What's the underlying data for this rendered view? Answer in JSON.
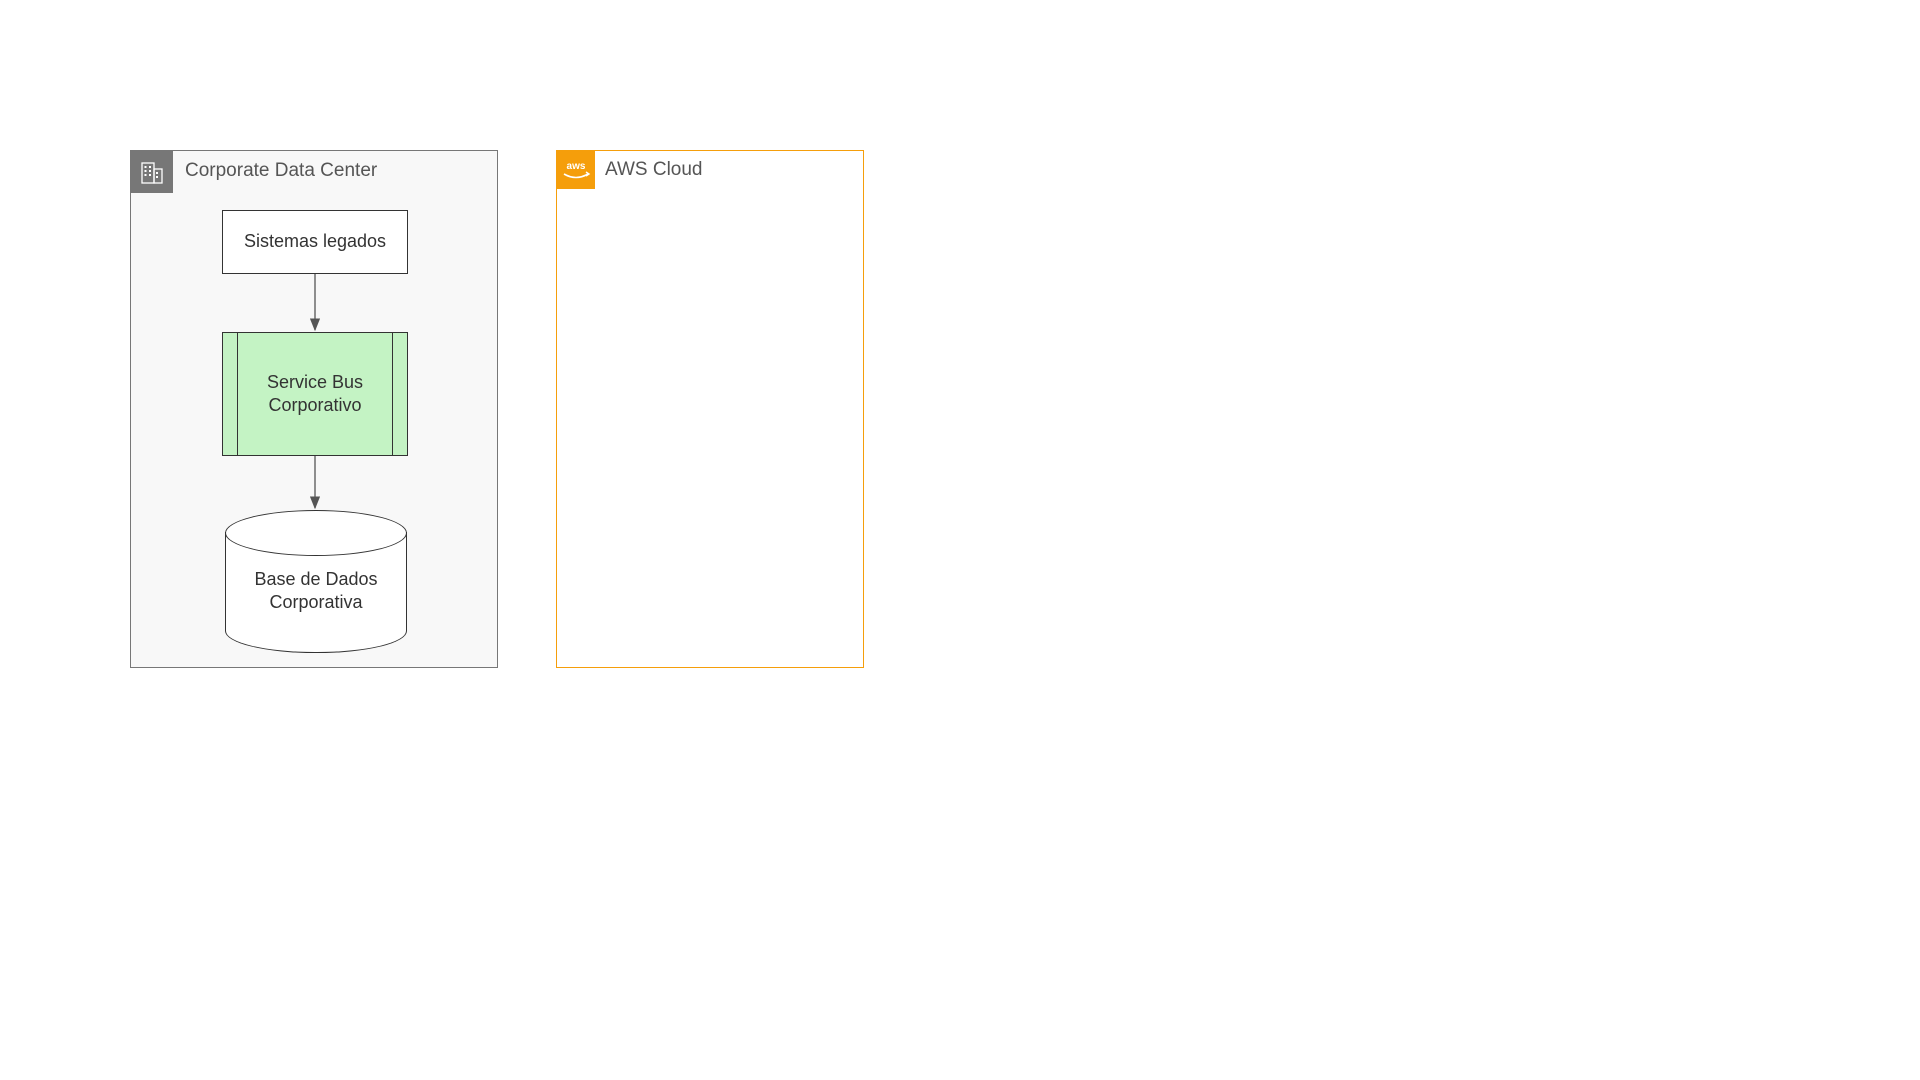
{
  "groups": {
    "corporateDataCenter": {
      "title": "Corporate Data Center"
    },
    "awsCloud": {
      "title": "AWS Cloud"
    }
  },
  "nodes": {
    "legacySystems": {
      "label": "Sistemas legados"
    },
    "serviceBus": {
      "label": "Service Bus\nCorporativo"
    },
    "corpDatabase": {
      "label": "Base de Dados\nCorporativa"
    }
  },
  "colors": {
    "cdcBorder": "#777777",
    "cdcFill": "#f8f8f8",
    "awsBorder": "#f59e0b",
    "serviceBusFill": "#c4f3c4",
    "arrow": "#555555"
  }
}
